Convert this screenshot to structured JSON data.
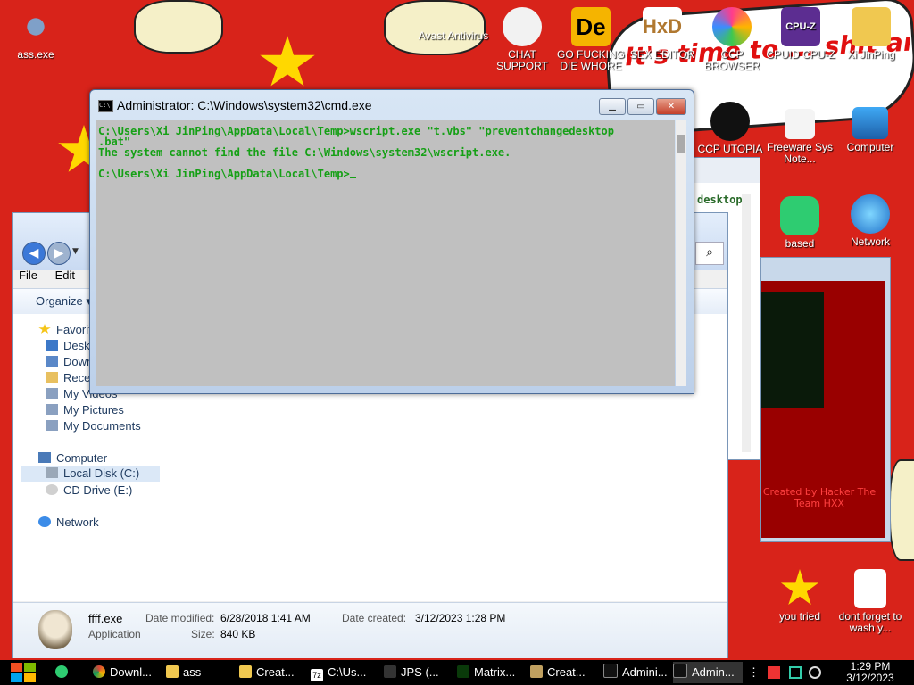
{
  "desktop": {
    "icons": [
      {
        "id": "ass",
        "label": "ass.exe"
      },
      {
        "id": "avast",
        "label": "Avast Antivirus"
      },
      {
        "id": "chat",
        "label": "CHAT SUPPORT"
      },
      {
        "id": "gofuck",
        "label": "GO FUCKING DIE WHORE"
      },
      {
        "id": "sexeditor",
        "label": "SEX EDITOR"
      },
      {
        "id": "ccp",
        "label": "CCP BROWSER"
      },
      {
        "id": "cpuz",
        "label": "CPUID CPU-Z"
      },
      {
        "id": "xijinping",
        "label": "Xi JinPing"
      },
      {
        "id": "ccputopia",
        "label": "CCP UTOPIA"
      },
      {
        "id": "freeware",
        "label": "Freeware Sys Note..."
      },
      {
        "id": "computer",
        "label": "Computer"
      },
      {
        "id": "based",
        "label": "based"
      },
      {
        "id": "network",
        "label": "Network"
      },
      {
        "id": "youtried",
        "label": "you tried"
      },
      {
        "id": "dontforget",
        "label": "dont forget to wash y..."
      }
    ],
    "banner_text": "It's time to ... shit and die and chew ... pilling",
    "behind_window_text": "Created by Hacker The Team HXX",
    "background_overlay_text": "desktop",
    "colors": {
      "background": "#d8231a",
      "star": "#ffd800"
    }
  },
  "cmd": {
    "title": "Administrator: C:\\Windows\\system32\\cmd.exe",
    "lines": [
      "C:\\Users\\Xi JinPing\\AppData\\Local\\Temp>wscript.exe \"t.vbs\" \"preventchangedesktop",
      ".bat\"",
      "The system cannot find the file C:\\Windows\\system32\\wscript.exe.",
      "",
      "C:\\Users\\Xi JinPing\\AppData\\Local\\Temp>"
    ],
    "text_color": "#16a016",
    "bg_color": "#c0c0c0"
  },
  "explorer": {
    "menu": [
      "File",
      "Edit"
    ],
    "toolbar": {
      "organize": "Organize"
    },
    "nav": {
      "favorites": "Favorites",
      "items": [
        "Desktop",
        "Downloads",
        "Recent Places",
        "My Videos",
        "My Pictures",
        "My Documents"
      ],
      "computer": "Computer",
      "computer_items": [
        "Local Disk (C:)",
        "CD Drive (E:)"
      ],
      "network": "Network"
    },
    "details": {
      "filename": "ffff.exe",
      "type": "Application",
      "modified_label": "Date modified:",
      "modified": "6/28/2018 1:41 AM",
      "created_label": "Date created:",
      "created": "3/12/2023 1:28 PM",
      "size_label": "Size:",
      "size": "840 KB"
    }
  },
  "taskbar": {
    "items": [
      "Downl...",
      "ass",
      "Creat...",
      "C:\\Us...",
      "JPS (...",
      "Matrix...",
      "Creat...",
      "Admini...",
      "Admin..."
    ],
    "time": "1:29 PM",
    "date": "3/12/2023"
  }
}
